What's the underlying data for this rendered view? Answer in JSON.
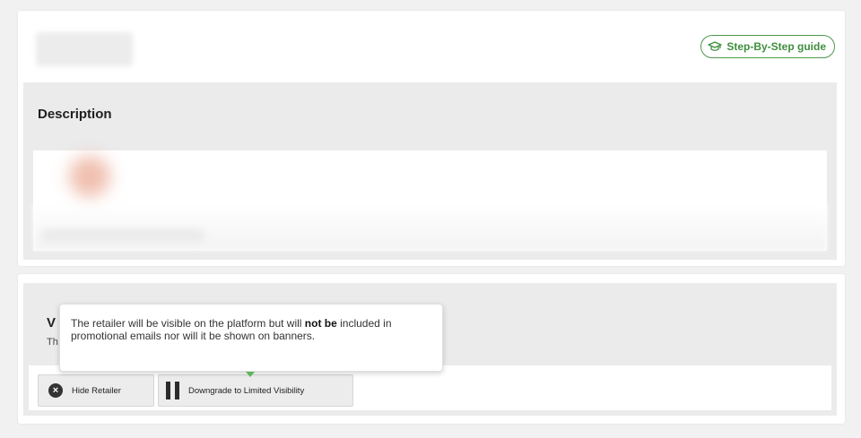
{
  "header": {
    "guide_button_label": "Step-By-Step guide"
  },
  "description": {
    "title": "Description"
  },
  "visibility": {
    "title_visible": "V",
    "subtitle_visible": "Th",
    "hide_button_label": "Hide Retailer",
    "downgrade_button_label": "Downgrade to Limited Visibility"
  },
  "tooltip": {
    "text_before": "The retailer will be visible on the platform but will ",
    "text_bold": "not be",
    "text_after": " included in promotional emails nor will it be shown on banners."
  },
  "colors": {
    "accent_green": "#3e8f3e",
    "panel_gray": "#ebebeb"
  },
  "icons": {
    "guide": "graduation-cap-icon",
    "hide": "close-circle-icon",
    "downgrade": "pause-icon"
  }
}
